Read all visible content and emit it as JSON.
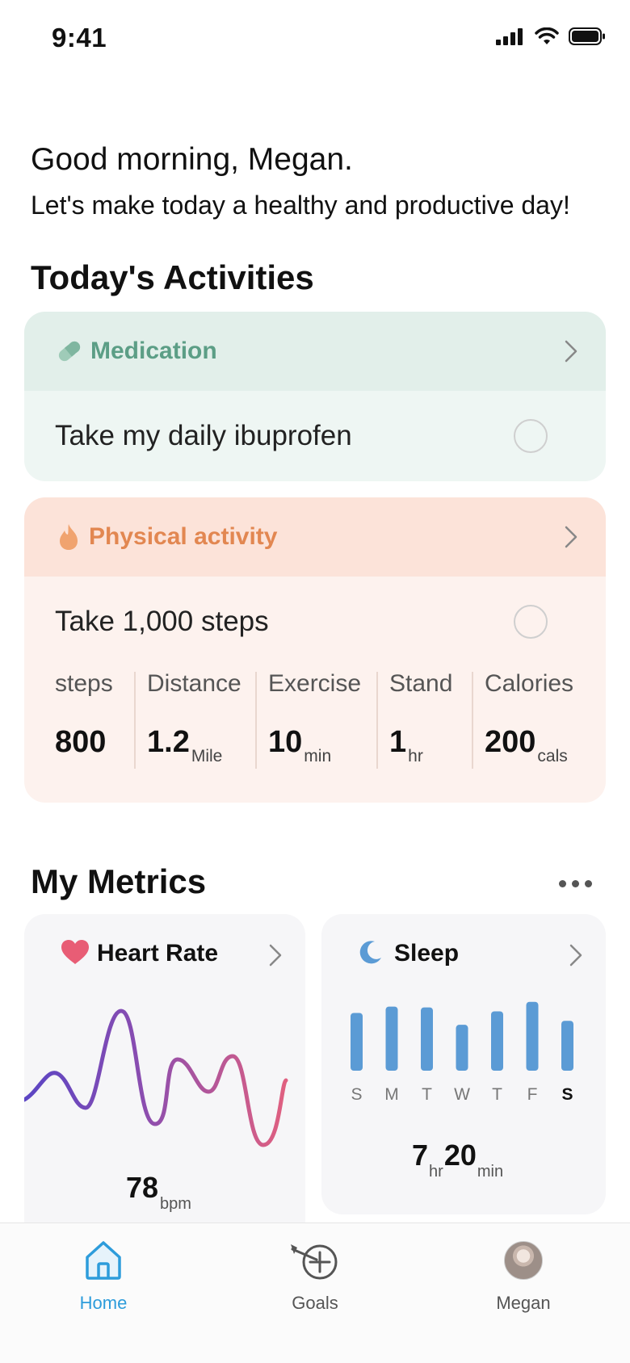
{
  "status_bar": {
    "time": "9:41"
  },
  "greeting": {
    "title": "Good morning, Megan.",
    "subtitle": "Let's make today a healthy and productive day!"
  },
  "activities": {
    "section_title": "Today's Activities",
    "medication": {
      "category": "Medication",
      "task": "Take my daily ibuprofen",
      "completed": false,
      "accent_color": "#5c9e86"
    },
    "physical": {
      "category": "Physical activity",
      "task": "Take 1,000 steps",
      "completed": false,
      "accent_color": "#e28751",
      "stats": [
        {
          "label": "steps",
          "value": "800",
          "unit": ""
        },
        {
          "label": "Distance",
          "value": "1.2",
          "unit": "Mile"
        },
        {
          "label": "Exercise",
          "value": "10",
          "unit": "min"
        },
        {
          "label": "Stand",
          "value": "1",
          "unit": "hr"
        },
        {
          "label": "Calories",
          "value": "200",
          "unit": "cals"
        }
      ]
    }
  },
  "metrics": {
    "section_title": "My Metrics",
    "heart_rate": {
      "title": "Heart Rate",
      "value": "78",
      "unit": "bpm",
      "icon": "heart-icon",
      "color": "#e85d75"
    },
    "sleep": {
      "title": "Sleep",
      "hours": "7",
      "hours_unit": "hr",
      "minutes": "20",
      "minutes_unit": "min",
      "icon": "moon-icon",
      "color": "#5b9bd5"
    }
  },
  "chart_data": [
    {
      "type": "bar",
      "categories": [
        "S",
        "M",
        "T",
        "W",
        "T",
        "F",
        "S"
      ],
      "values": [
        7.3,
        8.1,
        8.0,
        5.8,
        7.5,
        8.7,
        6.3
      ],
      "highlighted_index": 6,
      "title": "Sleep",
      "ylim": [
        0,
        10
      ],
      "grid": false,
      "color": "#5b9bd5"
    }
  ],
  "tab_bar": {
    "tabs": [
      {
        "label": "Home",
        "icon": "home-icon",
        "active": true
      },
      {
        "label": "Goals",
        "icon": "target-icon",
        "active": false
      },
      {
        "label": "Megan",
        "icon": "avatar",
        "active": false
      }
    ],
    "active_color": "#2d9cdb"
  }
}
